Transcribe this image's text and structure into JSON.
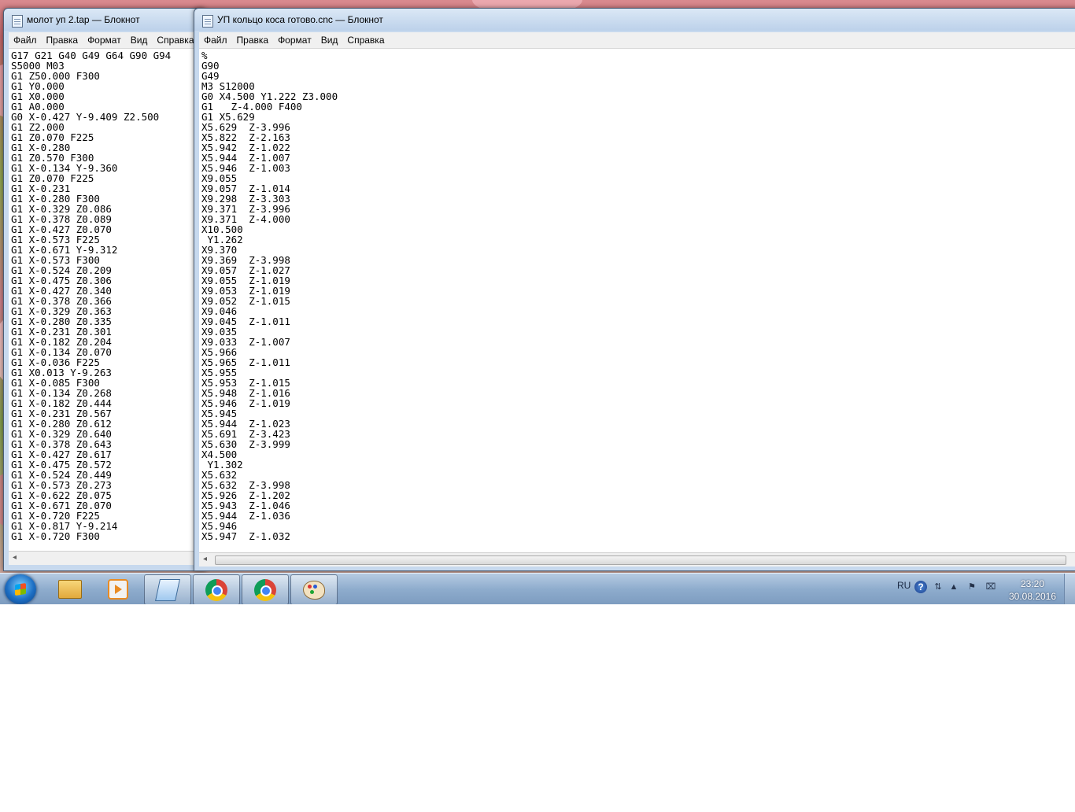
{
  "window_left": {
    "title": "молот уп 2.tap — Блокнот",
    "menu": [
      "Файл",
      "Правка",
      "Формат",
      "Вид",
      "Справка"
    ],
    "content": "G17 G21 G40 G49 G64 G90 G94\nS5000 M03\nG1 Z50.000 F300\nG1 Y0.000\nG1 X0.000\nG1 A0.000\nG0 X-0.427 Y-9.409 Z2.500\nG1 Z2.000\nG1 Z0.070 F225\nG1 X-0.280\nG1 Z0.570 F300\nG1 X-0.134 Y-9.360\nG1 Z0.070 F225\nG1 X-0.231\nG1 X-0.280 F300\nG1 X-0.329 Z0.086\nG1 X-0.378 Z0.089\nG1 X-0.427 Z0.070\nG1 X-0.573 F225\nG1 X-0.671 Y-9.312\nG1 X-0.573 F300\nG1 X-0.524 Z0.209\nG1 X-0.475 Z0.306\nG1 X-0.427 Z0.340\nG1 X-0.378 Z0.366\nG1 X-0.329 Z0.363\nG1 X-0.280 Z0.335\nG1 X-0.231 Z0.301\nG1 X-0.182 Z0.204\nG1 X-0.134 Z0.070\nG1 X-0.036 F225\nG1 X0.013 Y-9.263\nG1 X-0.085 F300\nG1 X-0.134 Z0.268\nG1 X-0.182 Z0.444\nG1 X-0.231 Z0.567\nG1 X-0.280 Z0.612\nG1 X-0.329 Z0.640\nG1 X-0.378 Z0.643\nG1 X-0.427 Z0.617\nG1 X-0.475 Z0.572\nG1 X-0.524 Z0.449\nG1 X-0.573 Z0.273\nG1 X-0.622 Z0.075\nG1 X-0.671 Z0.070\nG1 X-0.720 F225\nG1 X-0.817 Y-9.214\nG1 X-0.720 F300"
  },
  "window_right": {
    "title": "УП кольцо коса готово.cnc — Блокнот",
    "menu": [
      "Файл",
      "Правка",
      "Формат",
      "Вид",
      "Справка"
    ],
    "content": "%\nG90\nG49\nM3 S12000\nG0 X4.500 Y1.222 Z3.000\nG1   Z-4.000 F400\nG1 X5.629\nX5.629  Z-3.996\nX5.822  Z-2.163\nX5.942  Z-1.022\nX5.944  Z-1.007\nX5.946  Z-1.003\nX9.055\nX9.057  Z-1.014\nX9.298  Z-3.303\nX9.371  Z-3.996\nX9.371  Z-4.000\nX10.500\n Y1.262\nX9.370\nX9.369  Z-3.998\nX9.057  Z-1.027\nX9.055  Z-1.019\nX9.053  Z-1.019\nX9.052  Z-1.015\nX9.046\nX9.045  Z-1.011\nX9.035\nX9.033  Z-1.007\nX5.966\nX5.965  Z-1.011\nX5.955\nX5.953  Z-1.015\nX5.948  Z-1.016\nX5.946  Z-1.019\nX5.945\nX5.944  Z-1.023\nX5.691  Z-3.423\nX5.630  Z-3.999\nX4.500\n Y1.302\nX5.632\nX5.632  Z-3.998\nX5.926  Z-1.202\nX5.943  Z-1.046\nX5.944  Z-1.036\nX5.946\nX5.947  Z-1.032"
  },
  "taskbar": {
    "apps": [
      "windows-explorer",
      "media-player",
      "notepad",
      "chrome",
      "chrome",
      "paint"
    ],
    "language": "RU",
    "help_symbol": "?",
    "time": "23:20",
    "date": "30.08.2016"
  },
  "colors": {
    "taskbar": "#8eaccd",
    "titlebar": "#c7d9ee",
    "menubar": "#f0f0f0"
  }
}
